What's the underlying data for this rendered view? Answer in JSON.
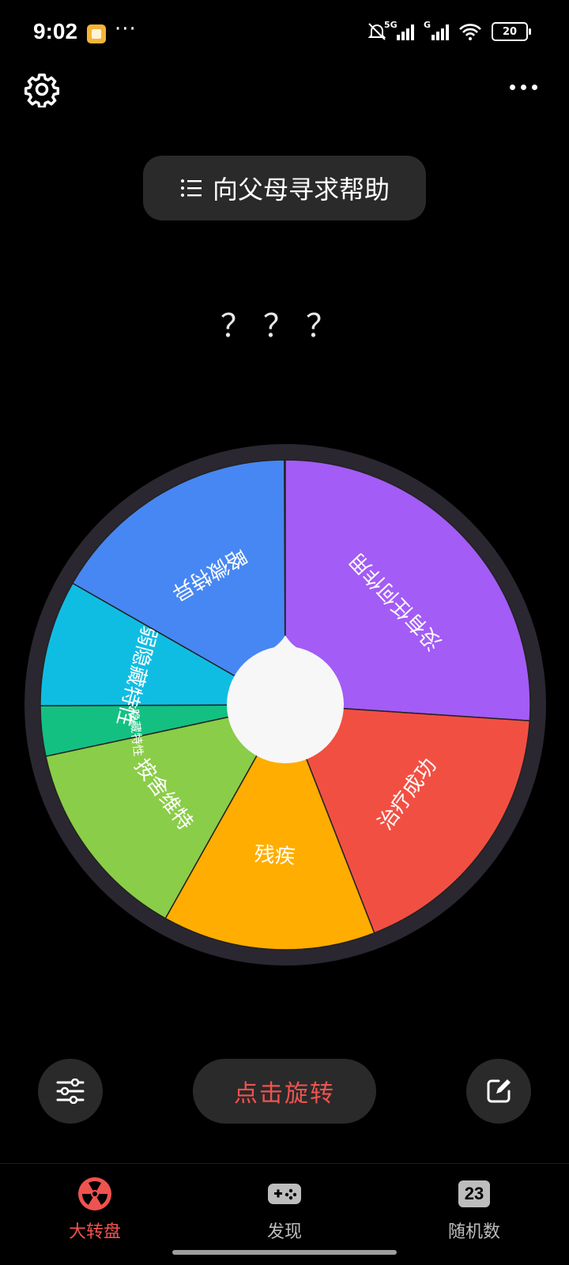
{
  "status_bar": {
    "time": "9:02",
    "more": "···",
    "battery": "20",
    "net_label_1": "5G",
    "net_label_2": "G"
  },
  "header": {
    "menu_icon": "more-horizontal-icon",
    "settings_icon": "gear-icon"
  },
  "title": {
    "icon": "list-icon",
    "text": "向父母寻求帮助"
  },
  "result": "？？？",
  "wheel": {
    "segments": [
      {
        "label": "没有任何作用",
        "color": "#a35cf5",
        "fraction": 0.2604
      },
      {
        "label": "治疗成功",
        "color": "#f24f43",
        "fraction": 0.1804
      },
      {
        "label": "残疾",
        "color": "#ffad00",
        "fraction": 0.1406
      },
      {
        "label": "按舍维特",
        "color": "#8acd48",
        "fraction": 0.1349
      },
      {
        "label": "强大隐藏特性",
        "color": "#13c082",
        "fraction": 0.0331
      },
      {
        "label": "较弱隐藏特性",
        "color": "#10bde2",
        "fraction": 0.0833
      },
      {
        "label": "略微特异",
        "color": "#4787f3",
        "fraction": 0.1667
      }
    ]
  },
  "controls": {
    "spin_label": "点击旋转",
    "settings_icon": "sliders-icon",
    "edit_icon": "edit-icon"
  },
  "tabs": [
    {
      "label": "大转盘",
      "icon": "radiation-icon",
      "active": true
    },
    {
      "label": "发现",
      "icon": "gamepad-icon",
      "active": false
    },
    {
      "label": "随机数",
      "icon": "number-icon",
      "icon_text": "23",
      "active": false
    }
  ]
}
